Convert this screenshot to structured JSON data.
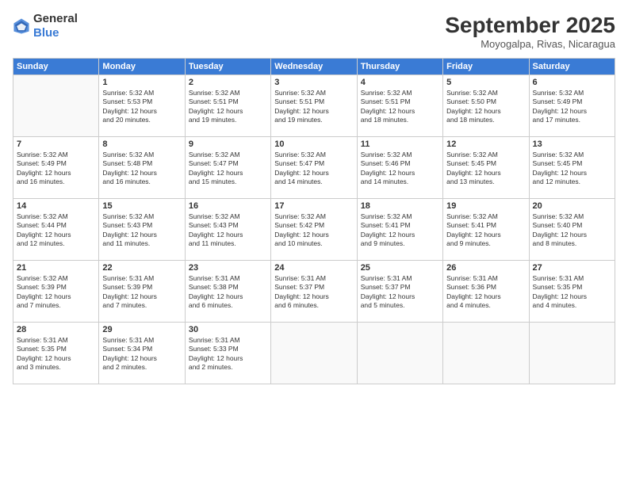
{
  "logo": {
    "general": "General",
    "blue": "Blue"
  },
  "title": "September 2025",
  "subtitle": "Moyogalpa, Rivas, Nicaragua",
  "days_header": [
    "Sunday",
    "Monday",
    "Tuesday",
    "Wednesday",
    "Thursday",
    "Friday",
    "Saturday"
  ],
  "weeks": [
    [
      {
        "day": "",
        "info": ""
      },
      {
        "day": "1",
        "info": "Sunrise: 5:32 AM\nSunset: 5:53 PM\nDaylight: 12 hours\nand 20 minutes."
      },
      {
        "day": "2",
        "info": "Sunrise: 5:32 AM\nSunset: 5:51 PM\nDaylight: 12 hours\nand 19 minutes."
      },
      {
        "day": "3",
        "info": "Sunrise: 5:32 AM\nSunset: 5:51 PM\nDaylight: 12 hours\nand 19 minutes."
      },
      {
        "day": "4",
        "info": "Sunrise: 5:32 AM\nSunset: 5:51 PM\nDaylight: 12 hours\nand 18 minutes."
      },
      {
        "day": "5",
        "info": "Sunrise: 5:32 AM\nSunset: 5:50 PM\nDaylight: 12 hours\nand 18 minutes."
      },
      {
        "day": "6",
        "info": "Sunrise: 5:32 AM\nSunset: 5:49 PM\nDaylight: 12 hours\nand 17 minutes."
      }
    ],
    [
      {
        "day": "7",
        "info": "Sunrise: 5:32 AM\nSunset: 5:49 PM\nDaylight: 12 hours\nand 16 minutes."
      },
      {
        "day": "8",
        "info": "Sunrise: 5:32 AM\nSunset: 5:48 PM\nDaylight: 12 hours\nand 16 minutes."
      },
      {
        "day": "9",
        "info": "Sunrise: 5:32 AM\nSunset: 5:47 PM\nDaylight: 12 hours\nand 15 minutes."
      },
      {
        "day": "10",
        "info": "Sunrise: 5:32 AM\nSunset: 5:47 PM\nDaylight: 12 hours\nand 14 minutes."
      },
      {
        "day": "11",
        "info": "Sunrise: 5:32 AM\nSunset: 5:46 PM\nDaylight: 12 hours\nand 14 minutes."
      },
      {
        "day": "12",
        "info": "Sunrise: 5:32 AM\nSunset: 5:45 PM\nDaylight: 12 hours\nand 13 minutes."
      },
      {
        "day": "13",
        "info": "Sunrise: 5:32 AM\nSunset: 5:45 PM\nDaylight: 12 hours\nand 12 minutes."
      }
    ],
    [
      {
        "day": "14",
        "info": "Sunrise: 5:32 AM\nSunset: 5:44 PM\nDaylight: 12 hours\nand 12 minutes."
      },
      {
        "day": "15",
        "info": "Sunrise: 5:32 AM\nSunset: 5:43 PM\nDaylight: 12 hours\nand 11 minutes."
      },
      {
        "day": "16",
        "info": "Sunrise: 5:32 AM\nSunset: 5:43 PM\nDaylight: 12 hours\nand 11 minutes."
      },
      {
        "day": "17",
        "info": "Sunrise: 5:32 AM\nSunset: 5:42 PM\nDaylight: 12 hours\nand 10 minutes."
      },
      {
        "day": "18",
        "info": "Sunrise: 5:32 AM\nSunset: 5:41 PM\nDaylight: 12 hours\nand 9 minutes."
      },
      {
        "day": "19",
        "info": "Sunrise: 5:32 AM\nSunset: 5:41 PM\nDaylight: 12 hours\nand 9 minutes."
      },
      {
        "day": "20",
        "info": "Sunrise: 5:32 AM\nSunset: 5:40 PM\nDaylight: 12 hours\nand 8 minutes."
      }
    ],
    [
      {
        "day": "21",
        "info": "Sunrise: 5:32 AM\nSunset: 5:39 PM\nDaylight: 12 hours\nand 7 minutes."
      },
      {
        "day": "22",
        "info": "Sunrise: 5:31 AM\nSunset: 5:39 PM\nDaylight: 12 hours\nand 7 minutes."
      },
      {
        "day": "23",
        "info": "Sunrise: 5:31 AM\nSunset: 5:38 PM\nDaylight: 12 hours\nand 6 minutes."
      },
      {
        "day": "24",
        "info": "Sunrise: 5:31 AM\nSunset: 5:37 PM\nDaylight: 12 hours\nand 6 minutes."
      },
      {
        "day": "25",
        "info": "Sunrise: 5:31 AM\nSunset: 5:37 PM\nDaylight: 12 hours\nand 5 minutes."
      },
      {
        "day": "26",
        "info": "Sunrise: 5:31 AM\nSunset: 5:36 PM\nDaylight: 12 hours\nand 4 minutes."
      },
      {
        "day": "27",
        "info": "Sunrise: 5:31 AM\nSunset: 5:35 PM\nDaylight: 12 hours\nand 4 minutes."
      }
    ],
    [
      {
        "day": "28",
        "info": "Sunrise: 5:31 AM\nSunset: 5:35 PM\nDaylight: 12 hours\nand 3 minutes."
      },
      {
        "day": "29",
        "info": "Sunrise: 5:31 AM\nSunset: 5:34 PM\nDaylight: 12 hours\nand 2 minutes."
      },
      {
        "day": "30",
        "info": "Sunrise: 5:31 AM\nSunset: 5:33 PM\nDaylight: 12 hours\nand 2 minutes."
      },
      {
        "day": "",
        "info": ""
      },
      {
        "day": "",
        "info": ""
      },
      {
        "day": "",
        "info": ""
      },
      {
        "day": "",
        "info": ""
      }
    ]
  ]
}
